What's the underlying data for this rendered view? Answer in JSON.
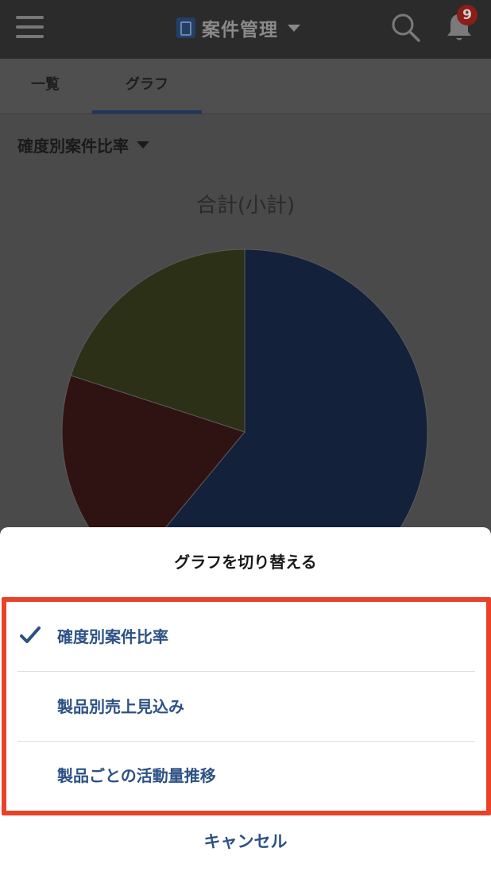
{
  "header": {
    "app_title": "案件管理",
    "notification_count": "9",
    "icons": [
      "menu-icon",
      "app-icon",
      "chevron-down-icon",
      "search-icon",
      "bell-icon"
    ]
  },
  "tabs": [
    {
      "label": "一覧",
      "active": false
    },
    {
      "label": "グラフ",
      "active": true
    }
  ],
  "graph_selector": {
    "label": "確度別案件比率"
  },
  "chart_data": {
    "type": "pie",
    "title": "合計(小計)",
    "slices": [
      {
        "value": 0.61,
        "color": "#14213a"
      },
      {
        "value": 0.19,
        "color": "#2f1312"
      },
      {
        "value": 0.2,
        "color": "#2b3017"
      }
    ]
  },
  "sheet": {
    "title": "グラフを切り替える",
    "options": [
      {
        "label": "確度別案件比率",
        "selected": true
      },
      {
        "label": "製品別売上見込み",
        "selected": false
      },
      {
        "label": "製品ごとの活動量推移",
        "selected": false
      }
    ],
    "cancel_label": "キャンセル"
  },
  "colors": {
    "accent": "#2c5185",
    "highlight_border": "#e8432a",
    "badge": "#8b1e16"
  }
}
